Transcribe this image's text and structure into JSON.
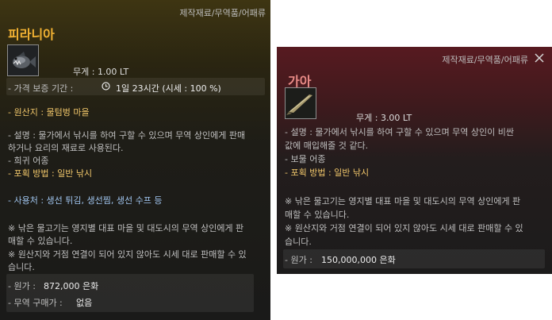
{
  "left": {
    "category": "제작재료/무역품/어패류",
    "name": "피라니아",
    "weight": "무게 :  1.00 LT",
    "guarantee_label": "- 가격 보증 기간 :",
    "guarantee_value": "1일 23시간 (시세 : 100 %)",
    "origin": "- 원산지 : 물텀벙 마을",
    "desc1": "- 설명 : 물가에서 낚시를 하여 구할 수 있으며 무역 상인에게 판매",
    "desc2": "하거나 요리의 재료로 사용된다.",
    "rarity": "- 희귀 어종",
    "catch": "- 포획 방법 : 일반 낚시",
    "usage": "- 사용처 : 생선 튀김, 생선찜, 생선 수프 등",
    "note1a": "※ 낚은 물고기는 영지별 대표 마을 및 대도시의 무역 상인에게 판",
    "note1b": "매할 수 있습니다.",
    "note2a": "※ 원산지와 거점 연결이 되어 있지 않아도 시세 대로 판매할 수 있",
    "note2b": "습니다.",
    "price_label": "- 원가 :",
    "price_value": "872,000 은화",
    "trade_label": "- 무역 구매가 :",
    "trade_value": "없음",
    "colors": {
      "title": "#f2b233"
    }
  },
  "right": {
    "category": "제작재료/무역품/어패류",
    "name": "가아",
    "weight": "무게 :  3.00 LT",
    "desc1": "- 설명 : 물가에서 낚시를 하여 구할 수 있으며 무역 상인이 비싼",
    "desc2": "값에 매입해줄 것 같다.",
    "rarity": "- 보물 어종",
    "catch": "- 포획 방법 : 일반 낚시",
    "note1a": "※ 낚은 물고기는 영지별 대표 마을 및 대도시의 무역 상인에게 판",
    "note1b": "매할 수 있습니다.",
    "note2a": "※ 원산지와 거점 연결이 되어 있지 않아도 시세 대로 판매할 수 있",
    "note2b": "습니다.",
    "price_label": "- 원가 :",
    "price_value": "150,000,000 은화",
    "colors": {
      "title": "#e88a86"
    }
  }
}
